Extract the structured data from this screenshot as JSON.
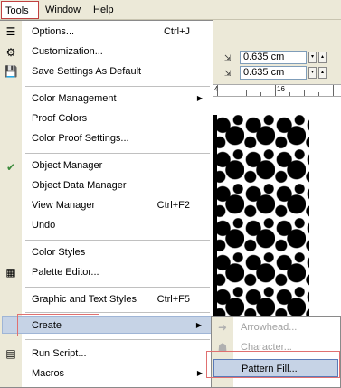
{
  "menubar": {
    "items": [
      "Tools",
      "Window",
      "Help"
    ]
  },
  "properties": {
    "nudge_x": "0.635 cm",
    "nudge_y": "0.635 cm"
  },
  "ruler": {
    "labels": [
      "4",
      "16"
    ]
  },
  "tools_menu": {
    "items": [
      {
        "label": "Options...",
        "shortcut": "Ctrl+J",
        "icon": "options-icon"
      },
      {
        "label": "Customization...",
        "shortcut": "",
        "icon": "customization-icon"
      },
      {
        "label": "Save Settings As Default",
        "shortcut": "",
        "icon": "save-icon"
      },
      {
        "label": "Color Management",
        "shortcut": "",
        "submenu": true
      },
      {
        "label": "Proof Colors",
        "shortcut": ""
      },
      {
        "label": "Color Proof Settings...",
        "shortcut": ""
      },
      {
        "label": "Object Manager",
        "shortcut": "",
        "checked": true
      },
      {
        "label": "Object Data Manager",
        "shortcut": ""
      },
      {
        "label": "View Manager",
        "shortcut": "Ctrl+F2"
      },
      {
        "label": "Undo",
        "shortcut": ""
      },
      {
        "label": "Color Styles",
        "shortcut": ""
      },
      {
        "label": "Palette Editor...",
        "shortcut": "",
        "icon": "palette-icon"
      },
      {
        "label": "Graphic and Text Styles",
        "shortcut": "Ctrl+F5"
      },
      {
        "label": "Create",
        "shortcut": "",
        "submenu": true,
        "highlighted": true
      },
      {
        "label": "Run Script...",
        "shortcut": "",
        "icon": "script-icon"
      },
      {
        "label": "Macros",
        "shortcut": "",
        "submenu": true
      }
    ]
  },
  "create_submenu": {
    "items": [
      {
        "label": "Arrowhead...",
        "disabled": true,
        "icon": "arrowhead-icon"
      },
      {
        "label": "Character...",
        "disabled": true,
        "icon": "character-icon"
      },
      {
        "label": "Pattern Fill...",
        "disabled": false,
        "highlighted": true,
        "icon": "pattern-fill-icon"
      }
    ]
  },
  "colors": {
    "highlight": "#c6d3e6",
    "menu_bg": "#ffffff",
    "gutter": "#ece9d8",
    "outline_red": "#e07070"
  }
}
